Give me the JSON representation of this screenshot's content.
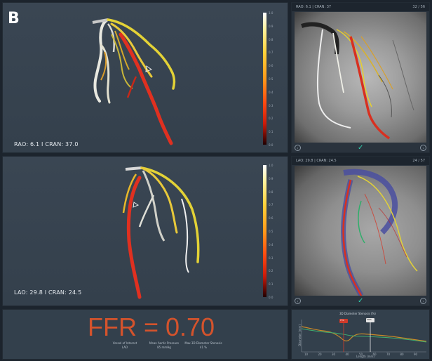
{
  "panel_label": "B",
  "top_view": {
    "angles_text": "RAO: 6.1  I  CRAN: 37.0",
    "angio_header_left": "RAO: 6.1 | CRAN: 37",
    "angio_header_right": "32 / 56"
  },
  "bottom_view": {
    "angles_text": "LAO: 29.8  I  CRAN: 24.5",
    "angio_header_left": "LAO: 29.8 | CRAN: 24.5",
    "angio_header_right": "24 / 57"
  },
  "colorbar_ticks": [
    "1.0",
    "0.9",
    "0.8",
    "0.7",
    "0.6",
    "0.5",
    "0.4",
    "0.3",
    "0.2",
    "0.1",
    "0.0"
  ],
  "nav": {
    "prev": "‹",
    "next": "›",
    "confirm": "✓"
  },
  "ffr_text": "FFR = 0.70",
  "metrics": [
    {
      "label": "Vessel of Interest",
      "value": "LAD"
    },
    {
      "label": "Mean Aortic Pressure",
      "value": "85 mmHg"
    },
    {
      "label": "Max 3D Diameter Stenosis",
      "value": "41 %"
    }
  ],
  "graph": {
    "title": "3D Diameter Stenosis (%)",
    "ylabel": "Diameter (mm)",
    "xlabel": "Length (mm)",
    "marker_left": "FFR",
    "marker_right": "MDS",
    "ticks_x": [
      "10",
      "20",
      "30",
      "40",
      "50",
      "60",
      "70",
      "80",
      "90"
    ]
  },
  "colors": {
    "ffr": "#d4532c",
    "accent": "#2fd4b0",
    "panel": "#3a4653"
  }
}
